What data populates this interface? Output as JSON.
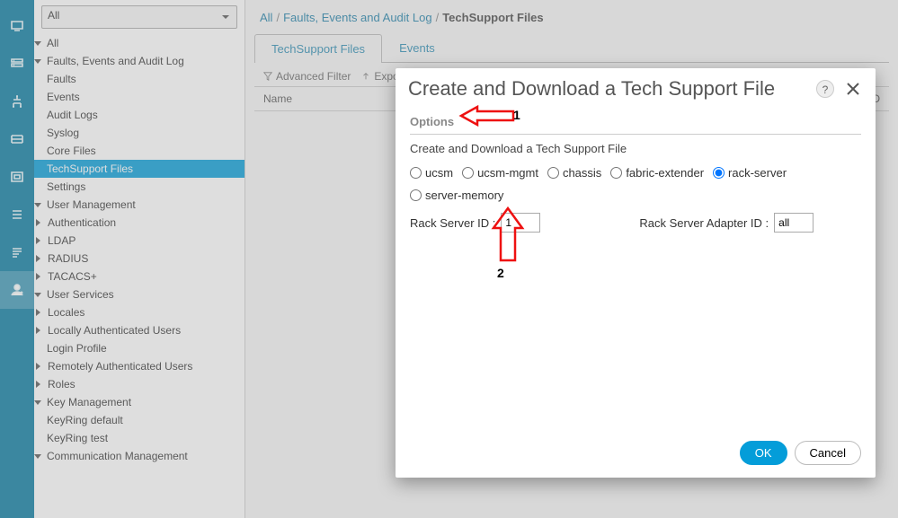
{
  "rail": {
    "items": [
      {
        "name": "rail-equipment",
        "icon": "computer"
      },
      {
        "name": "rail-servers",
        "icon": "server"
      },
      {
        "name": "rail-lan",
        "icon": "network"
      },
      {
        "name": "rail-san",
        "icon": "storage"
      },
      {
        "name": "rail-vm",
        "icon": "vm"
      },
      {
        "name": "rail-chassis",
        "icon": "list"
      },
      {
        "name": "rail-faults",
        "icon": "log"
      },
      {
        "name": "rail-admin",
        "icon": "admin",
        "active": true
      }
    ]
  },
  "scope_selector": {
    "value": "All"
  },
  "tree": [
    {
      "d": 0,
      "label": "All",
      "caret": "down"
    },
    {
      "d": 1,
      "label": "Faults, Events and Audit Log",
      "caret": "down"
    },
    {
      "d": 2,
      "label": "Faults"
    },
    {
      "d": 2,
      "label": "Events"
    },
    {
      "d": 2,
      "label": "Audit Logs"
    },
    {
      "d": 2,
      "label": "Syslog"
    },
    {
      "d": 2,
      "label": "Core Files"
    },
    {
      "d": 2,
      "label": "TechSupport Files",
      "selected": true
    },
    {
      "d": 2,
      "label": "Settings"
    },
    {
      "d": 1,
      "label": "User Management",
      "caret": "down"
    },
    {
      "d": 2,
      "label": "Authentication",
      "caret": "right"
    },
    {
      "d": 2,
      "label": "LDAP",
      "caret": "right"
    },
    {
      "d": 2,
      "label": "RADIUS",
      "caret": "right"
    },
    {
      "d": 2,
      "label": "TACACS+",
      "caret": "right"
    },
    {
      "d": 2,
      "label": "User Services",
      "caret": "down"
    },
    {
      "d": 3,
      "label": "Locales",
      "caret": "right"
    },
    {
      "d": 3,
      "label": "Locally Authenticated Users",
      "caret": "right"
    },
    {
      "d": 3,
      "label": "Login Profile"
    },
    {
      "d": 3,
      "label": "Remotely Authenticated Users",
      "caret": "right"
    },
    {
      "d": 3,
      "label": "Roles",
      "caret": "right"
    },
    {
      "d": 1,
      "label": "Key Management",
      "caret": "down"
    },
    {
      "d": 2,
      "label": "KeyRing default"
    },
    {
      "d": 2,
      "label": "KeyRing test"
    },
    {
      "d": 1,
      "label": "Communication Management",
      "caret": "down"
    }
  ],
  "breadcrumbs": {
    "items": [
      {
        "label": "All",
        "link": true
      },
      {
        "label": "Faults, Events and Audit Log",
        "link": true
      },
      {
        "label": "TechSupport Files",
        "current": true
      }
    ],
    "sep": "/"
  },
  "tabs": [
    {
      "label": "TechSupport Files",
      "active": true
    },
    {
      "label": "Events"
    }
  ],
  "toolbar": {
    "filter": "Advanced Filter",
    "export": "Export"
  },
  "table": {
    "columns": [
      "Name",
      "ric ID"
    ]
  },
  "modal": {
    "title": "Create and Download a Tech Support File",
    "section": "Options",
    "description": "Create and Download a Tech Support File",
    "radio_options": [
      {
        "value": "ucsm",
        "label": "ucsm"
      },
      {
        "value": "ucsm-mgmt",
        "label": "ucsm-mgmt"
      },
      {
        "value": "chassis",
        "label": "chassis"
      },
      {
        "value": "fabric-extender",
        "label": "fabric-extender"
      },
      {
        "value": "rack-server",
        "label": "rack-server",
        "checked": true
      },
      {
        "value": "server-memory",
        "label": "server-memory"
      }
    ],
    "rack_server_id_label": "Rack Server ID :",
    "rack_server_id_value": "1",
    "rack_server_adapter_id_label": "Rack Server Adapter ID :",
    "rack_server_adapter_id_value": "all",
    "help_label": "?",
    "ok_label": "OK",
    "cancel_label": "Cancel"
  },
  "annotations": {
    "label1": "1",
    "label2": "2"
  }
}
